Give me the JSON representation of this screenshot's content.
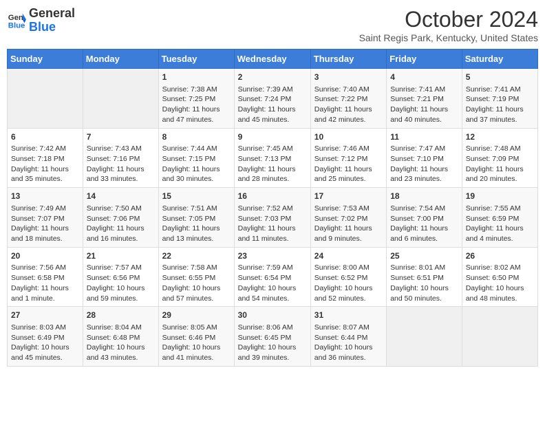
{
  "header": {
    "logo_general": "General",
    "logo_blue": "Blue",
    "title": "October 2024",
    "subtitle": "Saint Regis Park, Kentucky, United States"
  },
  "days_of_week": [
    "Sunday",
    "Monday",
    "Tuesday",
    "Wednesday",
    "Thursday",
    "Friday",
    "Saturday"
  ],
  "weeks": [
    [
      {
        "day": "",
        "empty": true
      },
      {
        "day": "",
        "empty": true
      },
      {
        "day": "1",
        "sunrise": "Sunrise: 7:38 AM",
        "sunset": "Sunset: 7:25 PM",
        "daylight": "Daylight: 11 hours and 47 minutes."
      },
      {
        "day": "2",
        "sunrise": "Sunrise: 7:39 AM",
        "sunset": "Sunset: 7:24 PM",
        "daylight": "Daylight: 11 hours and 45 minutes."
      },
      {
        "day": "3",
        "sunrise": "Sunrise: 7:40 AM",
        "sunset": "Sunset: 7:22 PM",
        "daylight": "Daylight: 11 hours and 42 minutes."
      },
      {
        "day": "4",
        "sunrise": "Sunrise: 7:41 AM",
        "sunset": "Sunset: 7:21 PM",
        "daylight": "Daylight: 11 hours and 40 minutes."
      },
      {
        "day": "5",
        "sunrise": "Sunrise: 7:41 AM",
        "sunset": "Sunset: 7:19 PM",
        "daylight": "Daylight: 11 hours and 37 minutes."
      }
    ],
    [
      {
        "day": "6",
        "sunrise": "Sunrise: 7:42 AM",
        "sunset": "Sunset: 7:18 PM",
        "daylight": "Daylight: 11 hours and 35 minutes."
      },
      {
        "day": "7",
        "sunrise": "Sunrise: 7:43 AM",
        "sunset": "Sunset: 7:16 PM",
        "daylight": "Daylight: 11 hours and 33 minutes."
      },
      {
        "day": "8",
        "sunrise": "Sunrise: 7:44 AM",
        "sunset": "Sunset: 7:15 PM",
        "daylight": "Daylight: 11 hours and 30 minutes."
      },
      {
        "day": "9",
        "sunrise": "Sunrise: 7:45 AM",
        "sunset": "Sunset: 7:13 PM",
        "daylight": "Daylight: 11 hours and 28 minutes."
      },
      {
        "day": "10",
        "sunrise": "Sunrise: 7:46 AM",
        "sunset": "Sunset: 7:12 PM",
        "daylight": "Daylight: 11 hours and 25 minutes."
      },
      {
        "day": "11",
        "sunrise": "Sunrise: 7:47 AM",
        "sunset": "Sunset: 7:10 PM",
        "daylight": "Daylight: 11 hours and 23 minutes."
      },
      {
        "day": "12",
        "sunrise": "Sunrise: 7:48 AM",
        "sunset": "Sunset: 7:09 PM",
        "daylight": "Daylight: 11 hours and 20 minutes."
      }
    ],
    [
      {
        "day": "13",
        "sunrise": "Sunrise: 7:49 AM",
        "sunset": "Sunset: 7:07 PM",
        "daylight": "Daylight: 11 hours and 18 minutes."
      },
      {
        "day": "14",
        "sunrise": "Sunrise: 7:50 AM",
        "sunset": "Sunset: 7:06 PM",
        "daylight": "Daylight: 11 hours and 16 minutes."
      },
      {
        "day": "15",
        "sunrise": "Sunrise: 7:51 AM",
        "sunset": "Sunset: 7:05 PM",
        "daylight": "Daylight: 11 hours and 13 minutes."
      },
      {
        "day": "16",
        "sunrise": "Sunrise: 7:52 AM",
        "sunset": "Sunset: 7:03 PM",
        "daylight": "Daylight: 11 hours and 11 minutes."
      },
      {
        "day": "17",
        "sunrise": "Sunrise: 7:53 AM",
        "sunset": "Sunset: 7:02 PM",
        "daylight": "Daylight: 11 hours and 9 minutes."
      },
      {
        "day": "18",
        "sunrise": "Sunrise: 7:54 AM",
        "sunset": "Sunset: 7:00 PM",
        "daylight": "Daylight: 11 hours and 6 minutes."
      },
      {
        "day": "19",
        "sunrise": "Sunrise: 7:55 AM",
        "sunset": "Sunset: 6:59 PM",
        "daylight": "Daylight: 11 hours and 4 minutes."
      }
    ],
    [
      {
        "day": "20",
        "sunrise": "Sunrise: 7:56 AM",
        "sunset": "Sunset: 6:58 PM",
        "daylight": "Daylight: 11 hours and 1 minute."
      },
      {
        "day": "21",
        "sunrise": "Sunrise: 7:57 AM",
        "sunset": "Sunset: 6:56 PM",
        "daylight": "Daylight: 10 hours and 59 minutes."
      },
      {
        "day": "22",
        "sunrise": "Sunrise: 7:58 AM",
        "sunset": "Sunset: 6:55 PM",
        "daylight": "Daylight: 10 hours and 57 minutes."
      },
      {
        "day": "23",
        "sunrise": "Sunrise: 7:59 AM",
        "sunset": "Sunset: 6:54 PM",
        "daylight": "Daylight: 10 hours and 54 minutes."
      },
      {
        "day": "24",
        "sunrise": "Sunrise: 8:00 AM",
        "sunset": "Sunset: 6:52 PM",
        "daylight": "Daylight: 10 hours and 52 minutes."
      },
      {
        "day": "25",
        "sunrise": "Sunrise: 8:01 AM",
        "sunset": "Sunset: 6:51 PM",
        "daylight": "Daylight: 10 hours and 50 minutes."
      },
      {
        "day": "26",
        "sunrise": "Sunrise: 8:02 AM",
        "sunset": "Sunset: 6:50 PM",
        "daylight": "Daylight: 10 hours and 48 minutes."
      }
    ],
    [
      {
        "day": "27",
        "sunrise": "Sunrise: 8:03 AM",
        "sunset": "Sunset: 6:49 PM",
        "daylight": "Daylight: 10 hours and 45 minutes."
      },
      {
        "day": "28",
        "sunrise": "Sunrise: 8:04 AM",
        "sunset": "Sunset: 6:48 PM",
        "daylight": "Daylight: 10 hours and 43 minutes."
      },
      {
        "day": "29",
        "sunrise": "Sunrise: 8:05 AM",
        "sunset": "Sunset: 6:46 PM",
        "daylight": "Daylight: 10 hours and 41 minutes."
      },
      {
        "day": "30",
        "sunrise": "Sunrise: 8:06 AM",
        "sunset": "Sunset: 6:45 PM",
        "daylight": "Daylight: 10 hours and 39 minutes."
      },
      {
        "day": "31",
        "sunrise": "Sunrise: 8:07 AM",
        "sunset": "Sunset: 6:44 PM",
        "daylight": "Daylight: 10 hours and 36 minutes."
      },
      {
        "day": "",
        "empty": true
      },
      {
        "day": "",
        "empty": true
      }
    ]
  ]
}
